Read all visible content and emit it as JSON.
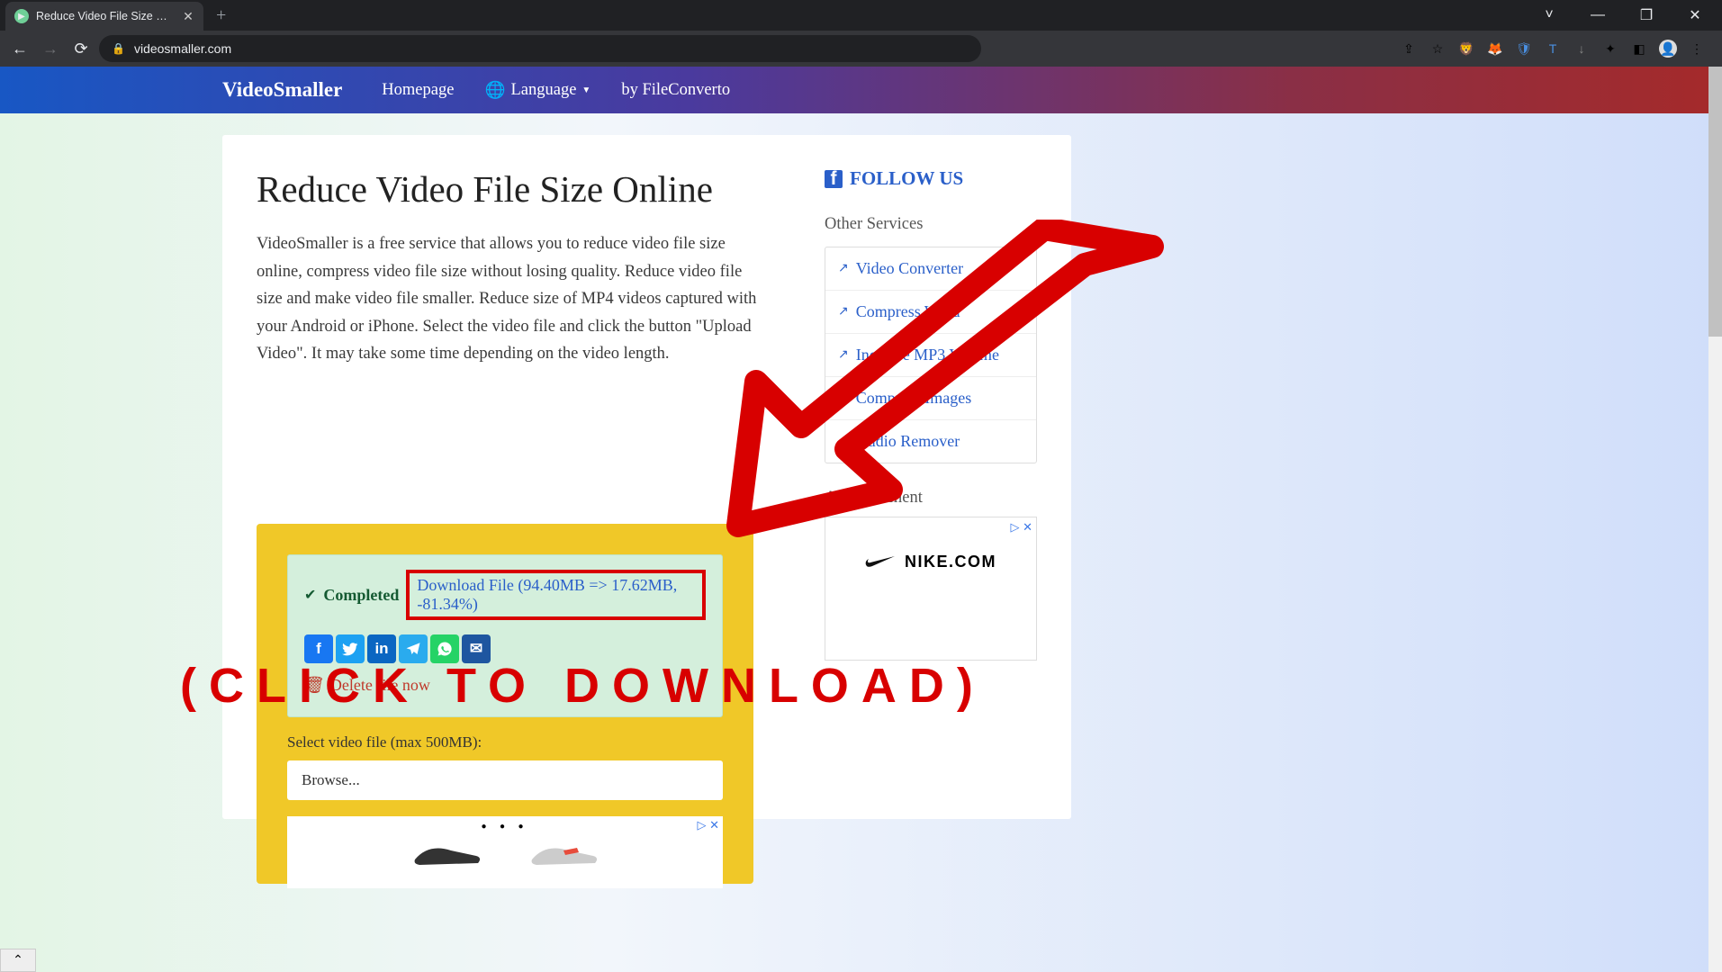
{
  "browser": {
    "tab_title": "Reduce Video File Size Online, M",
    "url": "videosmaller.com",
    "win": {
      "min": "—",
      "max": "❐",
      "close": "✕",
      "dropdown": "˅"
    }
  },
  "nav": {
    "brand": "VideoSmaller",
    "home": "Homepage",
    "lang": "Language",
    "by": "by FileConverto"
  },
  "main": {
    "title": "Reduce Video File Size Online",
    "paragraph": "VideoSmaller is a free service that allows you to reduce video file size online, compress video file size without losing quality. Reduce video file size and make video file smaller. Reduce size of MP4 videos captured with your Android or iPhone. Select the video file and click the button \"Upload Video\". It may take some time depending on the video length."
  },
  "result": {
    "completed": "Completed",
    "download_text": "Download File (94.40MB => 17.62MB, -81.34%)",
    "delete": "Delete file now"
  },
  "upload": {
    "label": "Select video file (max 500MB):",
    "browse": "Browse..."
  },
  "sidebar": {
    "follow": "FOLLOW US",
    "other": "Other Services",
    "services": [
      "Video Converter",
      "Compress Word",
      "Increase MP3 Volume",
      "Compress Images",
      "Audio Remover"
    ],
    "ads": "Advertisement",
    "nike": "NIKE.COM"
  },
  "overlay": {
    "text": "(CLICK TO DOWNLOAD)"
  },
  "social": {
    "fb": "f",
    "tw": "t",
    "li": "in",
    "tg": "✈",
    "wa": "✆",
    "em": "✉"
  },
  "icons": {
    "trash": "🗑",
    "check": "✔",
    "ext": "↗",
    "fb": "f",
    "globe": "🌐",
    "adchoices": "▷ ✕",
    "dots": "● ● ●"
  },
  "ext_icons": [
    "⇪",
    "☆",
    "🦁",
    "🦊",
    "🛡",
    "T",
    "↓",
    "✦",
    "◧"
  ],
  "avatar": "👤",
  "kebab": "⋮"
}
